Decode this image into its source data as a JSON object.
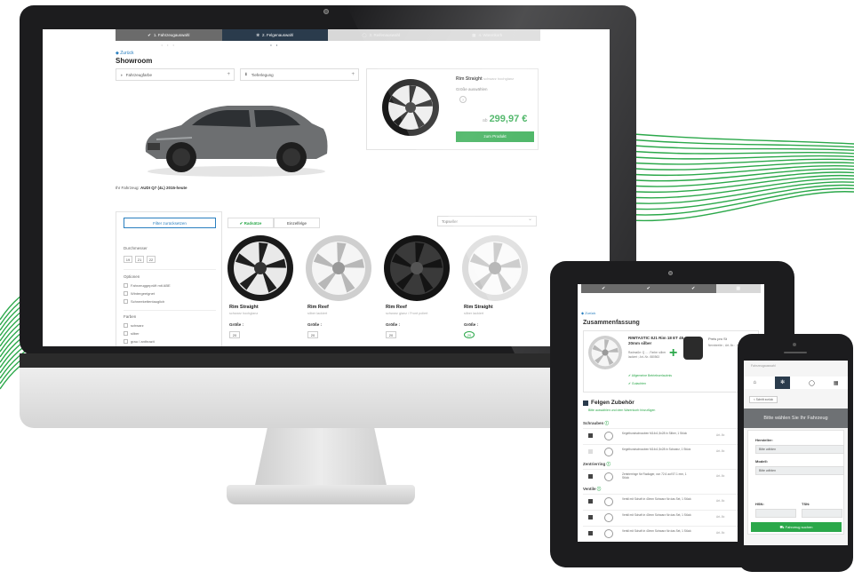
{
  "desktop": {
    "steps": [
      {
        "label": "1. Fahrzeugauswahl",
        "state": "done"
      },
      {
        "label": "2. Felgenauswahl",
        "state": "active"
      },
      {
        "label": "3. Reifenauswahl",
        "state": "todo"
      },
      {
        "label": "4. Warenkorb",
        "state": "todo"
      }
    ],
    "back_label": "Zurück",
    "page_title": "Showroom",
    "dropdown_color": "Fahrzeugfarbe",
    "dropdown_lowering": "Tieferlegung",
    "product": {
      "name": "Rim Straight",
      "variant": "schwarz hochglanz",
      "size_prompt": "Größe auswählen",
      "size_chip": "?",
      "price_prefix": "ab",
      "price": "299,97 €",
      "button": "zum Produkt"
    },
    "vehicle_prefix": "Ihr Fahrzeug:",
    "vehicle_name": "AUDI Q7 (4L) 2015-heute",
    "filter": {
      "reset": "Filter zurücksetzen",
      "diameter_label": "Durchmesser",
      "diameters": [
        "19",
        "21",
        "22"
      ],
      "options_label": "Optionen",
      "options": [
        "Fahrzeuggeprüft mit ABE",
        "Wintergeeignet",
        "Schneekettentauglich"
      ],
      "colors_label": "Farben",
      "colors": [
        "schwarz",
        "silber",
        "grau / anthrazit"
      ]
    },
    "tabs": [
      "Radsätze",
      "Einzelfelge"
    ],
    "sort_placeholder": "Topseller",
    "wheels": [
      {
        "name": "Rim Straight",
        "sub": "schwarz hochglanz",
        "size_label": "Größe :",
        "chip": "20"
      },
      {
        "name": "Rim Reef",
        "sub": "silber lackiert",
        "size_label": "Größe :",
        "chip": "20"
      },
      {
        "name": "Rim Reef",
        "sub": "schwarz glanz / Front poliert",
        "size_label": "Größe :",
        "chip": "20"
      },
      {
        "name": "Rim Straight",
        "sub": "silber lackiert",
        "size_label": "Größe :",
        "chip": "20"
      }
    ]
  },
  "tablet": {
    "back_label": "Zurück",
    "title": "Zusammenfassung",
    "rim_name": "RIMTASTIC 8J1 Rim 18 ET 45 20mm silber",
    "rim_meta": "Radmaße: Q ... ; Farbe: silber lackiert ; Art.-Nr.: 880563",
    "tyre_label": "Preis pro St",
    "tyre_meta": "Nennbreite: ; Art.-Nr.: ; Marke:",
    "link_1": "Allgemeine Betriebserlaubnis",
    "link_2": "Gutachten",
    "acc_title": "Felgen Zubehör",
    "acc_sub": "Bitte auswählen und dem Warenkorb hinzufügen",
    "sections": [
      "Schrauben",
      "Zentrierring",
      "Ventile"
    ],
    "rows": [
      {
        "desc": "Kegelbundschrauben M14x1,5x28 in Silber, 1 Stück",
        "price": "Art.-Nr."
      },
      {
        "desc": "Kegelbundschrauben M14x1,5x28 in Schwarz, 1 Stück",
        "price": "Art.-Nr."
      },
      {
        "desc": "Zentrierringe für Radlager, von 72.6 auf 57.1 mm, 1 Stück",
        "price": "Art.-Nr."
      },
      {
        "desc": "Ventil mit Schaft in 40mm Schwarz für das Set, 1 Stück",
        "price": "Art.-Nr."
      },
      {
        "desc": "Ventil mit Schaft in 40mm Schwarz für das Set, 1 Stück",
        "price": "Art.-Nr."
      },
      {
        "desc": "Ventil mit Schaft in 40mm Schwarz für das Set, 1 Stück",
        "price": "Art.-Nr."
      }
    ]
  },
  "phone": {
    "hint": "Fahrzeugauswahl",
    "reset": "< Schritt zurück",
    "banner": "Bitte wählen Sie Ihr Fahrzeug",
    "manufacturer_label": "Hersteller:",
    "manufacturer_value": "Bitte wählen",
    "model_label": "Modell:",
    "model_value": "Bitte wählen",
    "hsn_label": "HSN:",
    "tsn_label": "TSN:",
    "button": "Fahrzeug suchen"
  },
  "colors": {
    "accent_green": "#2ba84a",
    "active_step": "#2a3b4c",
    "link_blue": "#2a7fbf",
    "device_bezel": "#1c1c1e"
  }
}
